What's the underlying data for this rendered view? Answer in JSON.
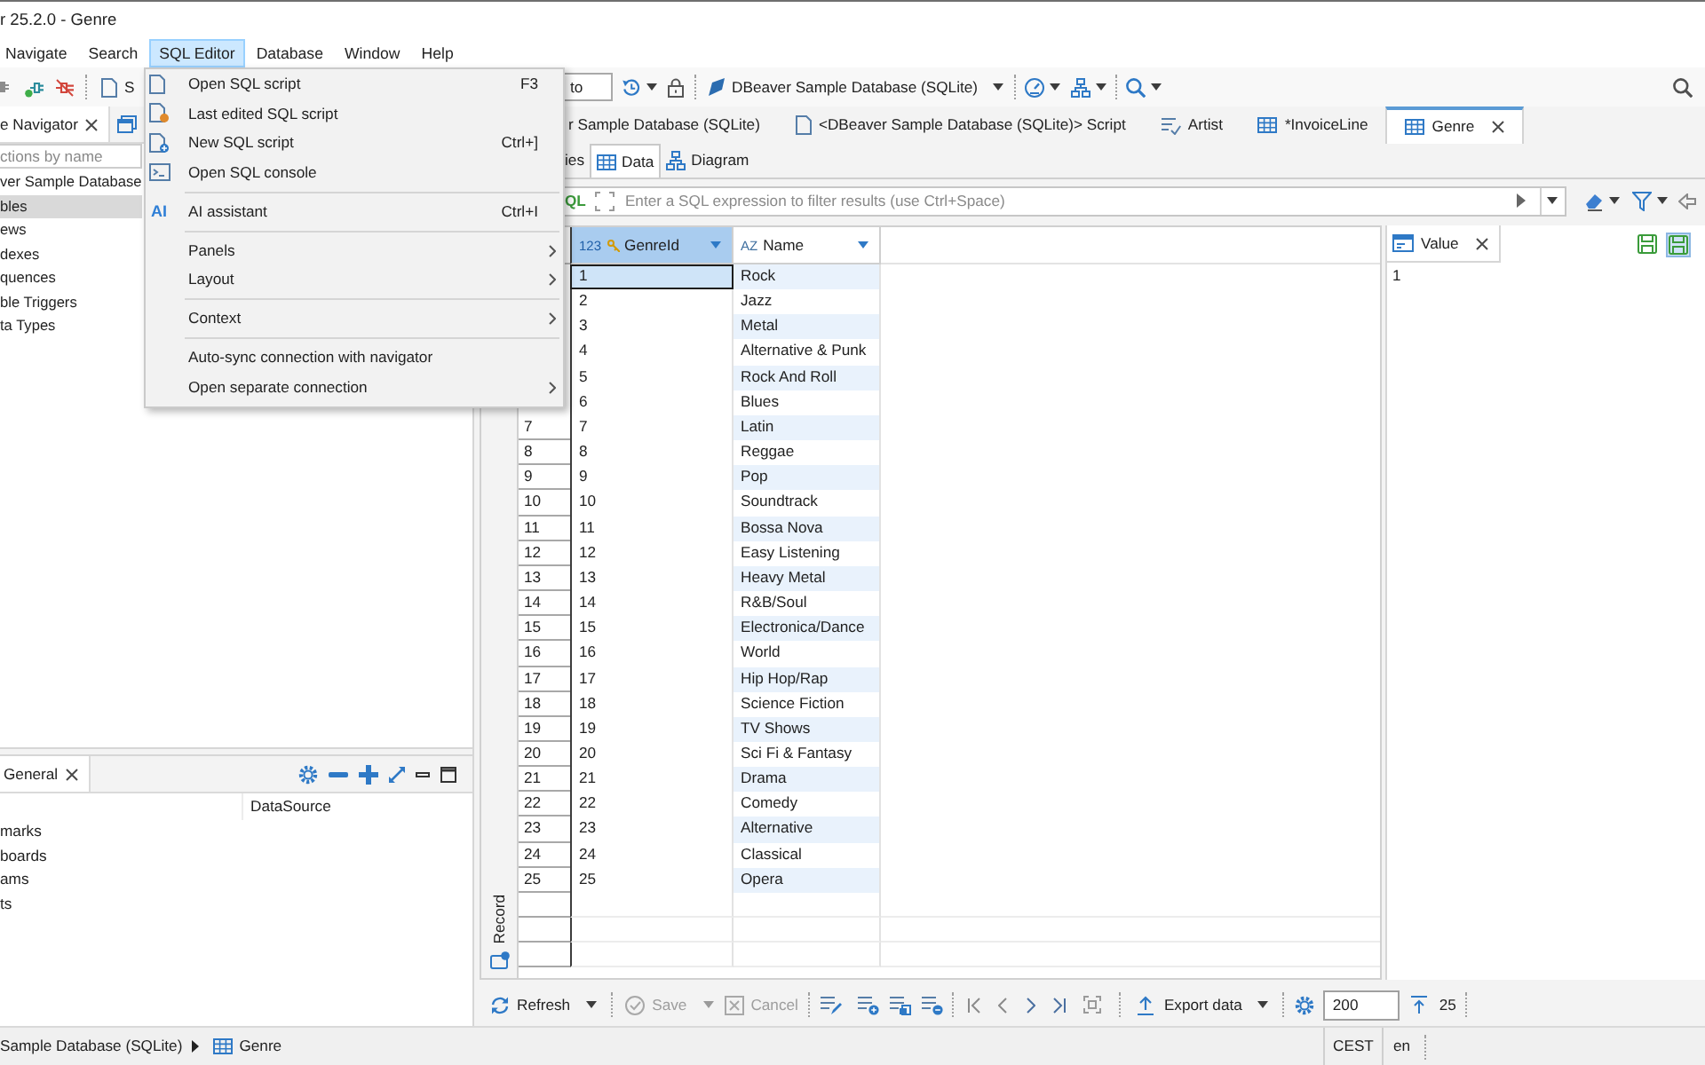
{
  "window": {
    "title": "r 25.2.0 - Genre"
  },
  "menu_bar": [
    {
      "label": "Navigate",
      "selected": false
    },
    {
      "label": "Search",
      "selected": false
    },
    {
      "label": "SQL Editor",
      "selected": true
    },
    {
      "label": "Database",
      "selected": false
    },
    {
      "label": "Window",
      "selected": false
    },
    {
      "label": "Help",
      "selected": false
    }
  ],
  "toolbar": {
    "sql_button": "S",
    "transaction_mode": "to",
    "datasource": "DBeaver Sample Database (SQLite)"
  },
  "open_menu": {
    "items": [
      {
        "kind": "item",
        "label": "Open SQL script",
        "shortcut": "F3",
        "submenu": false
      },
      {
        "kind": "item",
        "label": "Last edited SQL script",
        "submenu": false
      },
      {
        "kind": "item",
        "label": "New SQL script",
        "shortcut": "Ctrl+]",
        "submenu": false
      },
      {
        "kind": "item",
        "label": "Open SQL console",
        "submenu": false
      },
      {
        "kind": "separator"
      },
      {
        "kind": "item",
        "icon_text": "AI",
        "label": "AI assistant",
        "shortcut": "Ctrl+I",
        "submenu": false
      },
      {
        "kind": "separator"
      },
      {
        "kind": "item",
        "label": "Panels",
        "submenu": true
      },
      {
        "kind": "item",
        "label": "Layout",
        "submenu": true
      },
      {
        "kind": "separator"
      },
      {
        "kind": "item",
        "label": "Context",
        "submenu": true
      },
      {
        "kind": "separator"
      },
      {
        "kind": "item",
        "label": "Auto-sync connection with navigator",
        "submenu": false
      },
      {
        "kind": "item",
        "label": "Open separate connection",
        "submenu": true
      }
    ]
  },
  "navigator": {
    "tab": "e Navigator",
    "filter_placeholder": "ctions by name",
    "items": [
      {
        "label": "ver Sample Database",
        "selected": false
      },
      {
        "label": "bles",
        "selected": true
      },
      {
        "label": "ews",
        "selected": false
      },
      {
        "label": "dexes",
        "selected": false
      },
      {
        "label": "quences",
        "selected": false
      },
      {
        "label": "ble Triggers",
        "selected": false
      },
      {
        "label": "ta Types",
        "selected": false
      }
    ]
  },
  "properties_panel": {
    "tab": "General",
    "column_2": "DataSource",
    "items": [
      "marks",
      "boards",
      "ams",
      "ts"
    ]
  },
  "editor_tabs": [
    {
      "kind": "connection",
      "label": "r Sample Database (SQLite)",
      "selected": false
    },
    {
      "kind": "script",
      "label": "<DBeaver Sample Database (SQLite)> Script",
      "selected": false
    },
    {
      "kind": "view",
      "label": "Artist",
      "selected": false
    },
    {
      "kind": "table",
      "label": "*InvoiceLine",
      "selected": false
    },
    {
      "kind": "table",
      "label": "Genre",
      "selected": true
    }
  ],
  "sub_tabs": [
    {
      "kind": "properties",
      "label": "ies",
      "selected": false
    },
    {
      "kind": "data",
      "label": "Data",
      "selected": true
    },
    {
      "kind": "diagram",
      "label": "Diagram",
      "selected": false
    }
  ],
  "filter_bar": {
    "label": "QL",
    "placeholder": "Enter a SQL expression to filter results (use Ctrl+Space)"
  },
  "grid": {
    "columns": [
      {
        "type_label": "123",
        "label": "GenreId",
        "key": true,
        "selected": true
      },
      {
        "type_label": "AZ",
        "label": "Name",
        "key": false,
        "selected": false
      }
    ],
    "rows": [
      {
        "cells": [
          "1",
          "Rock"
        ],
        "selected": true
      },
      {
        "cells": [
          "2",
          "Jazz"
        ],
        "selected": false
      },
      {
        "cells": [
          "3",
          "Metal"
        ],
        "selected": false
      },
      {
        "cells": [
          "4",
          "Alternative & Punk"
        ],
        "selected": false
      },
      {
        "cells": [
          "5",
          "Rock And Roll"
        ],
        "selected": false
      },
      {
        "cells": [
          "6",
          "Blues"
        ],
        "selected": false
      },
      {
        "row_number": "7",
        "cells": [
          "7",
          "Latin"
        ],
        "selected": false
      },
      {
        "row_number": "8",
        "cells": [
          "8",
          "Reggae"
        ],
        "selected": false
      },
      {
        "row_number": "9",
        "cells": [
          "9",
          "Pop"
        ],
        "selected": false
      },
      {
        "row_number": "10",
        "cells": [
          "10",
          "Soundtrack"
        ],
        "selected": false
      },
      {
        "row_number": "11",
        "cells": [
          "11",
          "Bossa Nova"
        ],
        "selected": false
      },
      {
        "row_number": "12",
        "cells": [
          "12",
          "Easy Listening"
        ],
        "selected": false
      },
      {
        "row_number": "13",
        "cells": [
          "13",
          "Heavy Metal"
        ],
        "selected": false
      },
      {
        "row_number": "14",
        "cells": [
          "14",
          "R&B/Soul"
        ],
        "selected": false
      },
      {
        "row_number": "15",
        "cells": [
          "15",
          "Electronica/Dance"
        ],
        "selected": false
      },
      {
        "row_number": "16",
        "cells": [
          "16",
          "World"
        ],
        "selected": false
      },
      {
        "row_number": "17",
        "cells": [
          "17",
          "Hip Hop/Rap"
        ],
        "selected": false
      },
      {
        "row_number": "18",
        "cells": [
          "18",
          "Science Fiction"
        ],
        "selected": false
      },
      {
        "row_number": "19",
        "cells": [
          "19",
          "TV Shows"
        ],
        "selected": false
      },
      {
        "row_number": "20",
        "cells": [
          "20",
          "Sci Fi & Fantasy"
        ],
        "selected": false
      },
      {
        "row_number": "21",
        "cells": [
          "21",
          "Drama"
        ],
        "selected": false
      },
      {
        "row_number": "22",
        "cells": [
          "22",
          "Comedy"
        ],
        "selected": false
      },
      {
        "row_number": "23",
        "cells": [
          "23",
          "Alternative"
        ],
        "selected": false
      },
      {
        "row_number": "24",
        "cells": [
          "24",
          "Classical"
        ],
        "selected": false
      },
      {
        "row_number": "25",
        "cells": [
          "25",
          "Opera"
        ],
        "selected": false
      }
    ]
  },
  "record_toggle": {
    "label": "Record"
  },
  "value_panel": {
    "tab": "Value",
    "value": "1",
    "buttons": [
      {
        "pressed": false
      },
      {
        "pressed": true
      }
    ]
  },
  "result_toolbar": {
    "buttons": [
      {
        "label": "Refresh",
        "disabled": false,
        "dropdown": true
      },
      {
        "label": "Save",
        "disabled": true,
        "dropdown": true
      },
      {
        "label": "Cancel",
        "disabled": true,
        "dropdown": false
      }
    ],
    "export": "Export data",
    "fetch_size": "200",
    "row_count": "25"
  },
  "status_bar": {
    "path": "Sample Database (SQLite)",
    "table": "Genre",
    "timezone": "CEST",
    "locale": "en"
  }
}
